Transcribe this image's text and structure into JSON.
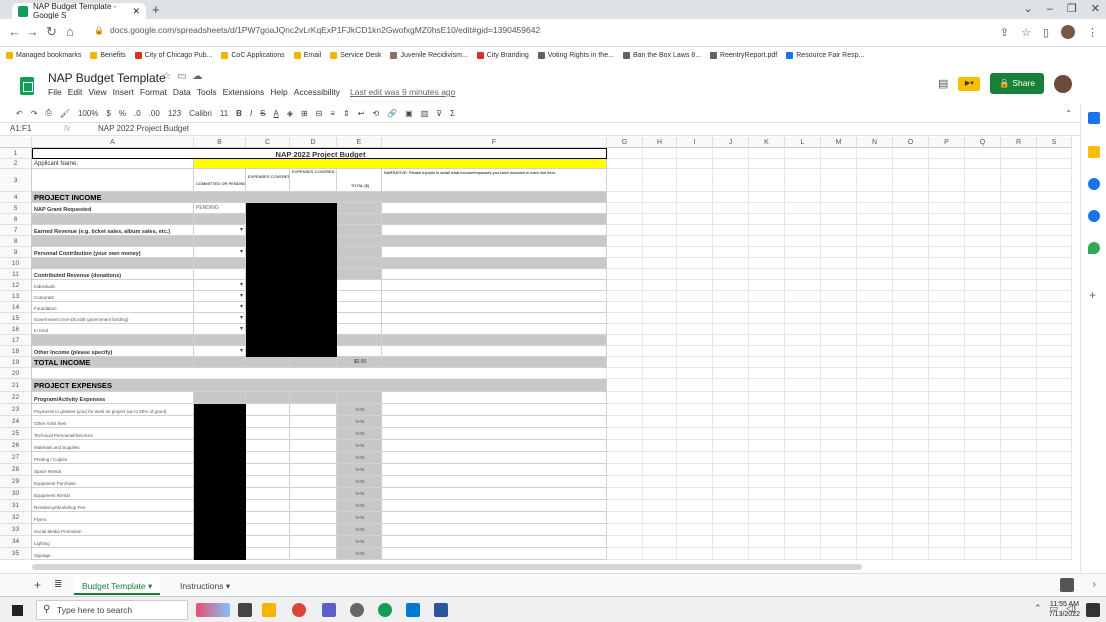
{
  "browser": {
    "tab_title": "NAP Budget Template - Google S",
    "url": "docs.google.com/spreadsheets/d/1PW7goaJQnc2vLrKqExP1FJkCD1kn2GwofxgMZ0hsE10/edit#gid=1390459642",
    "bookmarks": [
      {
        "label": "Managed bookmarks",
        "color": "#f4b400"
      },
      {
        "label": "Benefits",
        "color": "#f4b400"
      },
      {
        "label": "City of Chicago Pub...",
        "color": "#d93025"
      },
      {
        "label": "CoC Applications",
        "color": "#f4b400"
      },
      {
        "label": "Email",
        "color": "#f4b400"
      },
      {
        "label": "Service Desk",
        "color": "#f4b400"
      },
      {
        "label": "Juvenile Recidivism...",
        "color": "#8d6e63"
      },
      {
        "label": "City Branding",
        "color": "#d93025"
      },
      {
        "label": "Voting Rights in the...",
        "color": "#5f6368"
      },
      {
        "label": "Ban the Box Laws 8...",
        "color": "#5f6368"
      },
      {
        "label": "ReentryReport.pdf",
        "color": "#5f6368"
      },
      {
        "label": "Resource Fair Resp...",
        "color": "#1a73e8"
      }
    ]
  },
  "doc": {
    "title": "NAP Budget Template",
    "menu": [
      "File",
      "Edit",
      "View",
      "Insert",
      "Format",
      "Data",
      "Tools",
      "Extensions",
      "Help",
      "Accessibility"
    ],
    "last_edit": "Last edit was 9 minutes ago",
    "share_label": "Share"
  },
  "toolbar": {
    "zoom": "100%",
    "currency": "$",
    "percent": "%",
    "dec_less": ".0",
    "dec_more": ".00",
    "format_123": "123",
    "font": "Calibri",
    "font_size": "11",
    "bold": "B",
    "italic": "I",
    "strike": "S",
    "text_color": "A"
  },
  "formula_bar": {
    "name_box": "A1:F1",
    "fx": "fx",
    "value": "NAP 2022 Project Budget"
  },
  "columns": [
    "A",
    "B",
    "C",
    "D",
    "E",
    "F",
    "G",
    "H",
    "I",
    "J",
    "K",
    "L",
    "M",
    "N",
    "O",
    "P",
    "Q",
    "R",
    "S"
  ],
  "rows": [
    "1",
    "2",
    "3",
    "4",
    "5",
    "6",
    "7",
    "8",
    "9",
    "10",
    "11",
    "12",
    "13",
    "14",
    "15",
    "16",
    "17",
    "18",
    "19",
    "20",
    "21",
    "22",
    "23",
    "24",
    "25",
    "26",
    "27",
    "28",
    "29",
    "30",
    "31",
    "32",
    "33",
    "34",
    "35"
  ],
  "sheet": {
    "title": "NAP 2022 Project Budget",
    "applicant_label": "Applicant Name:",
    "col_b_header": "COMMITTED OR PENDING?",
    "col_c_header": "EXPENSES COVERED BY DCASE ($)",
    "col_d_header": "EXPENSES COVERED BY OTHER FUNDING ($)",
    "col_e_header": "TOTAL ($)",
    "narrative_header": "NARRATIVE: Please explain in detail what income/expenses you have included in each line item.",
    "project_income": "PROJECT INCOME",
    "nap_grant": "NAP Grant Requested",
    "pending": "PENDING",
    "earned_revenue": "Earned Revenue (e.g. ticket sales, album sales, etc.)",
    "personal_contribution": "Personal Contribution (your own money)",
    "contributed_revenue": "Contributed Revenue (donations)",
    "individuals": "Individuals",
    "corporate": "Corporate",
    "foundation": "Foundation",
    "government": "Government (non-DCASE government funding)",
    "in_kind": "In Kind",
    "other_income": "Other Income (please specify)",
    "total_income": "TOTAL INCOME",
    "total_income_value": "$0.00",
    "project_expenses": "PROJECT EXPENSES",
    "program_expenses": "Program/Activity Expenses",
    "expense_lines": [
      "Payments to grantee (you) for work on project (up to 20% of grant)",
      "Other Artist fees",
      "Technical Personnel/Services",
      "Materials and Supplies",
      "Printing / Copies",
      "Space Rental",
      "Equipment Purchase",
      "Equipment Rental",
      "Residency/Workshop Fee",
      "Flyers",
      "Social Media Promotion",
      "Lighting",
      "Signage"
    ],
    "zero_value": "0.00"
  },
  "tabs": {
    "active": "Budget Template",
    "second": "Instructions"
  },
  "taskbar": {
    "search_placeholder": "Type here to search",
    "time": "11:55 AM",
    "date": "7/13/2022"
  }
}
